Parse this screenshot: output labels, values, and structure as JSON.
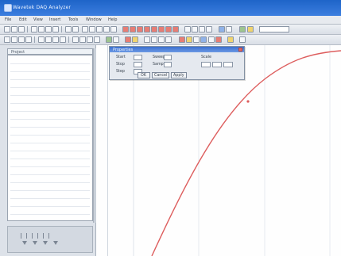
{
  "window": {
    "title": "Wavetek DAQ Analyzer",
    "menu": [
      "File",
      "Edit",
      "View",
      "Insert",
      "Tools",
      "Window",
      "Help"
    ]
  },
  "toolbar": {
    "search_placeholder": "",
    "icons": [
      "new-icon",
      "open-icon",
      "save-icon",
      "print-icon",
      "cut-icon",
      "copy-icon",
      "paste-icon",
      "undo-icon",
      "redo-icon",
      "zoom-in-icon",
      "zoom-out-icon",
      "grid-icon",
      "cursor-icon",
      "marker-icon",
      "pan-icon",
      "fit-icon",
      "ruler-icon",
      "settings-icon",
      "help-icon"
    ]
  },
  "left_panel": {
    "header_label": "Project",
    "list_lines": 20
  },
  "dialog": {
    "title": "Properties",
    "labels": [
      "Start",
      "Stop",
      "Step",
      "Sweep",
      "Samples",
      "Scale"
    ],
    "buttons": [
      "OK",
      "Cancel",
      "Apply"
    ]
  },
  "plot": {
    "curve_color": "#dd5d5d",
    "line_color": "#dfe4eb"
  }
}
